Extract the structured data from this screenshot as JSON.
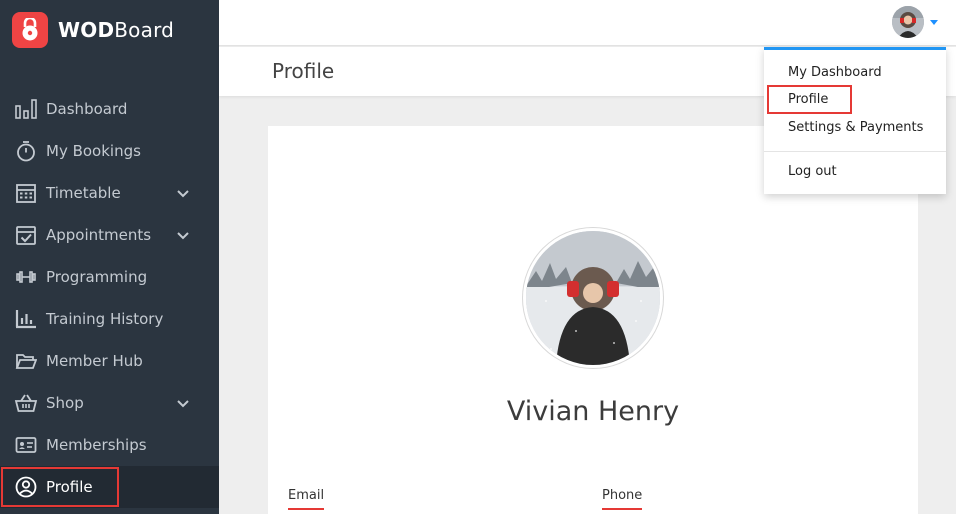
{
  "brand": {
    "name_bold": "WOD",
    "name_regular": "Board"
  },
  "sidebar": {
    "items": [
      {
        "label": "Dashboard",
        "icon": "bar-chart-icon"
      },
      {
        "label": "My Bookings",
        "icon": "stopwatch-icon"
      },
      {
        "label": "Timetable",
        "icon": "calendar-icon",
        "expandable": true
      },
      {
        "label": "Appointments",
        "icon": "calendar-check-icon",
        "expandable": true
      },
      {
        "label": "Programming",
        "icon": "dumbbell-icon"
      },
      {
        "label": "Training History",
        "icon": "bar-graph-icon"
      },
      {
        "label": "Member Hub",
        "icon": "folder-open-icon"
      },
      {
        "label": "Shop",
        "icon": "basket-icon",
        "expandable": true
      },
      {
        "label": "Memberships",
        "icon": "id-card-icon"
      },
      {
        "label": "Profile",
        "icon": "user-circle-icon",
        "active": true
      }
    ]
  },
  "header": {
    "page_title": "Profile"
  },
  "user_menu": {
    "items": [
      {
        "label": "My Dashboard"
      },
      {
        "label": "Profile",
        "highlighted": true
      },
      {
        "label": "Settings & Payments"
      },
      {
        "label": "Log out"
      }
    ]
  },
  "profile": {
    "name": "Vivian Henry",
    "fields": [
      {
        "label": "Email"
      },
      {
        "label": "Phone"
      }
    ]
  },
  "colors": {
    "sidebar_bg": "#2b3540",
    "brand_red": "#ef4444",
    "accent_blue": "#2196f3",
    "highlight_red": "#e53935"
  }
}
